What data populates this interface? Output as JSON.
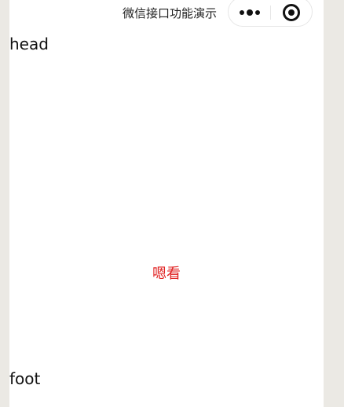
{
  "window": {
    "title": "微信接口功能演示"
  },
  "capsule": {
    "more_icon": "more-dots-icon",
    "close_icon": "target-close-icon"
  },
  "content": {
    "head": "head",
    "center": "嗯看",
    "foot": "foot"
  },
  "colors": {
    "background": "#ebe9e4",
    "page": "#ffffff",
    "center_text": "#e02020",
    "text": "#111111"
  }
}
